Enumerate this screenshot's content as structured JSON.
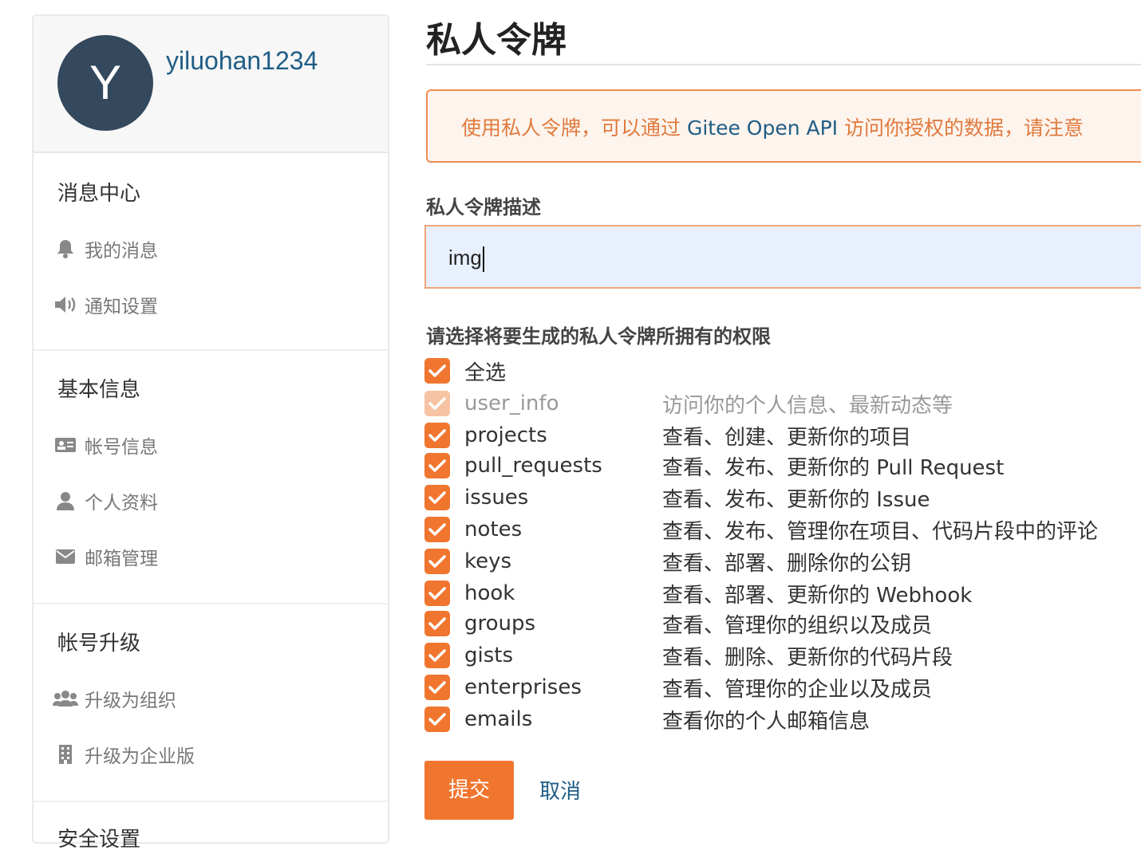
{
  "sidebar": {
    "avatar_letter": "Y",
    "username": "yiluohan1234",
    "sections": [
      {
        "title": "消息中心",
        "items": [
          {
            "label": "我的消息",
            "icon": "bell-icon"
          },
          {
            "label": "通知设置",
            "icon": "volume-icon"
          }
        ]
      },
      {
        "title": "基本信息",
        "items": [
          {
            "label": "帐号信息",
            "icon": "id-card-icon"
          },
          {
            "label": "个人资料",
            "icon": "user-icon"
          },
          {
            "label": "邮箱管理",
            "icon": "envelope-icon"
          }
        ]
      },
      {
        "title": "帐号升级",
        "items": [
          {
            "label": "升级为组织",
            "icon": "users-icon"
          },
          {
            "label": "升级为企业版",
            "icon": "building-icon"
          }
        ]
      },
      {
        "title": "安全设置",
        "items": []
      }
    ]
  },
  "main": {
    "title": "私人令牌",
    "notice": {
      "before": "使用私人令牌，可以通过 ",
      "api": "Gitee Open API",
      "after": " 访问你授权的数据，请注意"
    },
    "description_label": "私人令牌描述",
    "description_value": "img",
    "permissions_label": "请选择将要生成的私人令牌所拥有的权限",
    "select_all": {
      "label": "全选",
      "checked": true
    },
    "permissions": [
      {
        "name": "user_info",
        "desc": "访问你的个人信息、最新动态等",
        "checked": true,
        "disabled": true
      },
      {
        "name": "projects",
        "desc": "查看、创建、更新你的项目",
        "checked": true,
        "disabled": false
      },
      {
        "name": "pull_requests",
        "desc": "查看、发布、更新你的 Pull Request",
        "checked": true,
        "disabled": false
      },
      {
        "name": "issues",
        "desc": "查看、发布、更新你的 Issue",
        "checked": true,
        "disabled": false
      },
      {
        "name": "notes",
        "desc": "查看、发布、管理你在项目、代码片段中的评论",
        "checked": true,
        "disabled": false
      },
      {
        "name": "keys",
        "desc": "查看、部署、删除你的公钥",
        "checked": true,
        "disabled": false
      },
      {
        "name": "hook",
        "desc": "查看、部署、更新你的 Webhook",
        "checked": true,
        "disabled": false
      },
      {
        "name": "groups",
        "desc": "查看、管理你的组织以及成员",
        "checked": true,
        "disabled": false
      },
      {
        "name": "gists",
        "desc": "查看、删除、更新你的代码片段",
        "checked": true,
        "disabled": false
      },
      {
        "name": "enterprises",
        "desc": "查看、管理你的企业以及成员",
        "checked": true,
        "disabled": false
      },
      {
        "name": "emails",
        "desc": "查看你的个人邮箱信息",
        "checked": true,
        "disabled": false
      }
    ],
    "submit_label": "提交",
    "cancel_label": "取消"
  },
  "colors": {
    "accent": "#f0762f",
    "link": "#1f5d86",
    "avatar_bg": "#34495e"
  }
}
